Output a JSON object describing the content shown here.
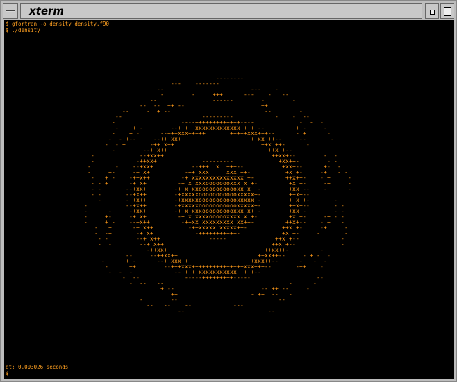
{
  "window": {
    "title": "xterm"
  },
  "terminal": {
    "lines": [
      "$ gfortran -o density density.f90",
      "$ ./density"
    ],
    "footer": "dt: 0.003026 seconds",
    "prompt": "$"
  },
  "colors": {
    "text": "#ffa020",
    "background": "#000000",
    "chrome": "#bdbdbd"
  },
  "icons": {
    "menu": "window-menu-icon",
    "minimize": "minimize-icon",
    "maximize": "maximize-icon"
  }
}
